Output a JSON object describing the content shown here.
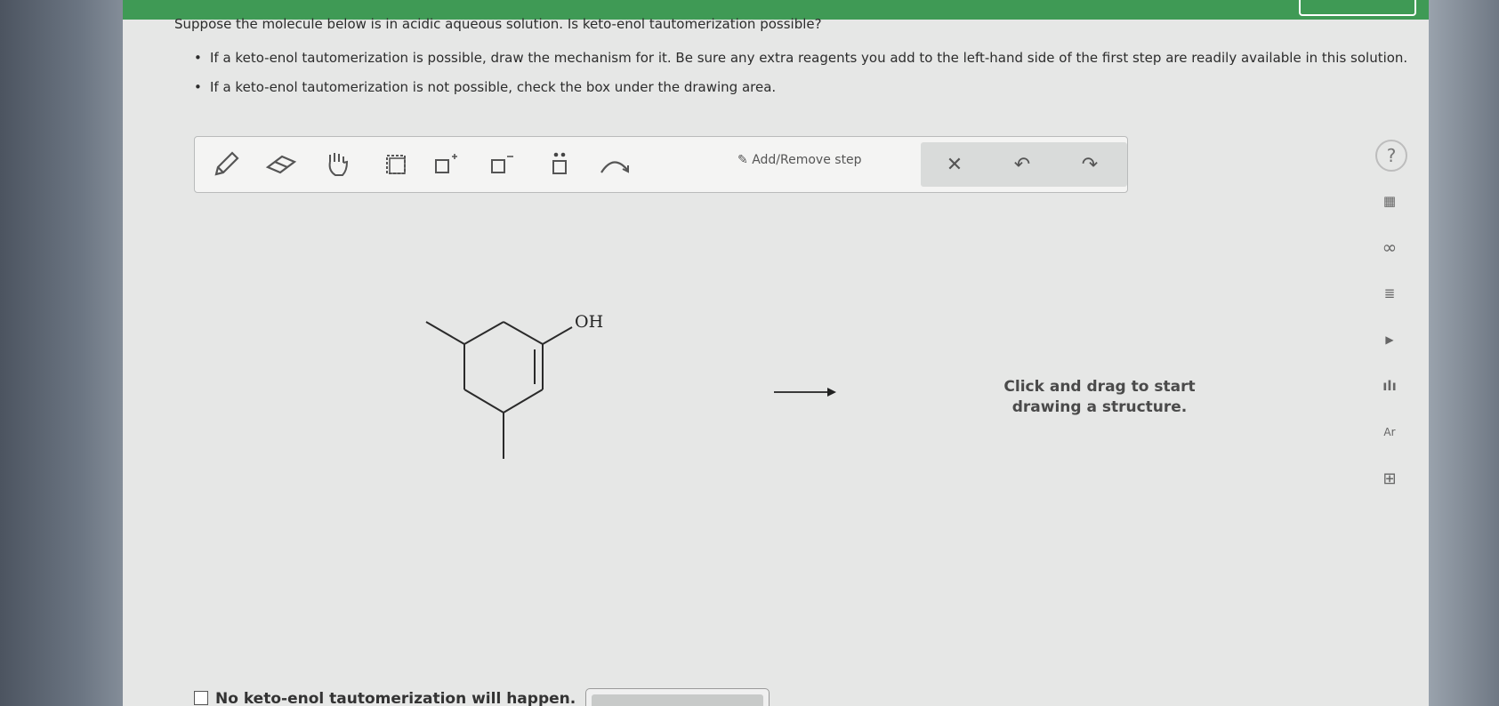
{
  "question": "Suppose the molecule below is in acidic aqueous solution. Is keto-enol tautomerization possible?",
  "bullets": [
    "If a keto-enol tautomerization is possible, draw the mechanism for it. Be sure any extra reagents you add to the left-hand side of the first step are readily available in this solution.",
    "If a keto-enol tautomerization is not possible, check the box under the drawing area."
  ],
  "toolbar": {
    "tools": [
      {
        "name": "pencil-icon"
      },
      {
        "name": "eraser-icon"
      },
      {
        "name": "hand-icon"
      },
      {
        "name": "selection-box-icon"
      },
      {
        "name": "add-charge-plus-icon"
      },
      {
        "name": "add-charge-minus-icon"
      },
      {
        "name": "lone-pair-icon"
      },
      {
        "name": "curved-arrow-icon"
      }
    ],
    "add_remove_step": "Add/Remove step",
    "actions": [
      {
        "name": "clear-x-icon",
        "glyph": "✕"
      },
      {
        "name": "undo-icon",
        "glyph": "↶"
      },
      {
        "name": "redo-icon",
        "glyph": "↷"
      }
    ]
  },
  "molecule": {
    "oh_label": "OH"
  },
  "canvas_hint": "Click and drag to start drawing a structure.",
  "sidebar": [
    {
      "name": "help-icon",
      "glyph": "?"
    },
    {
      "name": "calculator-icon",
      "glyph": "▦"
    },
    {
      "name": "infinity-icon",
      "glyph": "∞"
    },
    {
      "name": "notes-icon",
      "glyph": "≣"
    },
    {
      "name": "video-icon",
      "glyph": "▶"
    },
    {
      "name": "chart-icon",
      "glyph": "ılı"
    },
    {
      "name": "periodic-table-icon",
      "glyph": "Ar"
    },
    {
      "name": "data-table-icon",
      "glyph": "⊞"
    }
  ],
  "no_reaction_label": "No keto-enol tautomerization will happen."
}
